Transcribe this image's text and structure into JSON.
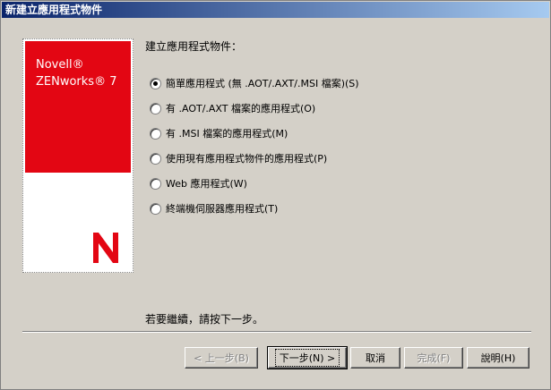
{
  "window": {
    "title": "新建立應用程式物件"
  },
  "banner": {
    "brand_line1": "Novell®",
    "brand_line2": "ZENworks® 7",
    "logo": "N"
  },
  "heading": "建立應用程式物件：",
  "options": [
    {
      "label": "簡單應用程式 (無 .AOT/.AXT/.MSI 檔案)(S)",
      "checked": true
    },
    {
      "label": "有 .AOT/.AXT 檔案的應用程式(O)",
      "checked": false
    },
    {
      "label": "有 .MSI 檔案的應用程式(M)",
      "checked": false
    },
    {
      "label": "使用現有應用程式物件的應用程式(P)",
      "checked": false
    },
    {
      "label": "Web 應用程式(W)",
      "checked": false
    },
    {
      "label": "終端機伺服器應用程式(T)",
      "checked": false
    }
  ],
  "continue_text": "若要繼續，請按下一步。",
  "buttons": {
    "back": "< 上一步(B)",
    "next": "下一步(N) >",
    "cancel": "取消",
    "finish": "完成(F)",
    "help": "說明(H)"
  },
  "colors": {
    "titlebar_start": "#0a246a",
    "titlebar_end": "#a6caf0",
    "brand_red": "#e30613",
    "dialog_bg": "#d4d0c8"
  }
}
